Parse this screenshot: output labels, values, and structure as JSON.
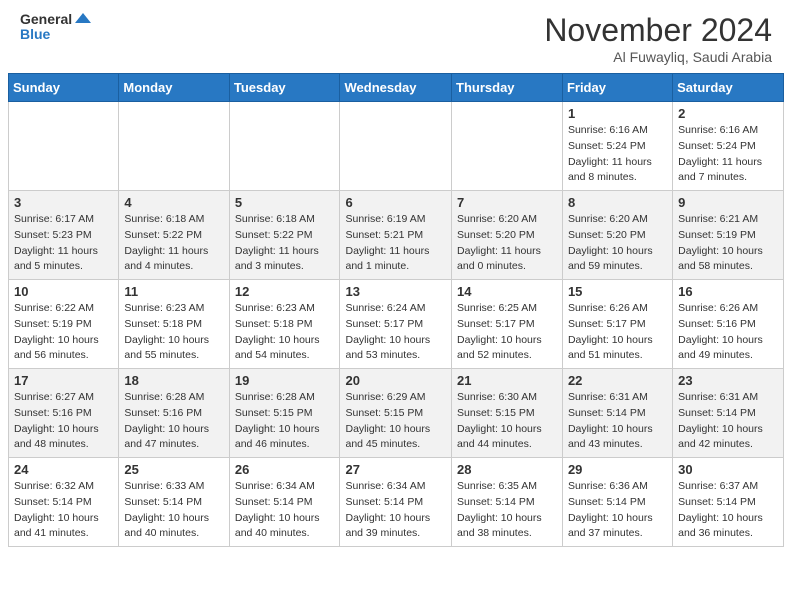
{
  "header": {
    "logo_general": "General",
    "logo_blue": "Blue",
    "month_title": "November 2024",
    "subtitle": "Al Fuwayliq, Saudi Arabia"
  },
  "calendar": {
    "days_of_week": [
      "Sunday",
      "Monday",
      "Tuesday",
      "Wednesday",
      "Thursday",
      "Friday",
      "Saturday"
    ],
    "weeks": [
      [
        {
          "day": "",
          "empty": true
        },
        {
          "day": "",
          "empty": true
        },
        {
          "day": "",
          "empty": true
        },
        {
          "day": "",
          "empty": true
        },
        {
          "day": "",
          "empty": true
        },
        {
          "day": "1",
          "sunrise": "6:16 AM",
          "sunset": "5:24 PM",
          "daylight": "11 hours and 8 minutes."
        },
        {
          "day": "2",
          "sunrise": "6:16 AM",
          "sunset": "5:24 PM",
          "daylight": "11 hours and 7 minutes."
        }
      ],
      [
        {
          "day": "3",
          "sunrise": "6:17 AM",
          "sunset": "5:23 PM",
          "daylight": "11 hours and 5 minutes."
        },
        {
          "day": "4",
          "sunrise": "6:18 AM",
          "sunset": "5:22 PM",
          "daylight": "11 hours and 4 minutes."
        },
        {
          "day": "5",
          "sunrise": "6:18 AM",
          "sunset": "5:22 PM",
          "daylight": "11 hours and 3 minutes."
        },
        {
          "day": "6",
          "sunrise": "6:19 AM",
          "sunset": "5:21 PM",
          "daylight": "11 hours and 1 minute."
        },
        {
          "day": "7",
          "sunrise": "6:20 AM",
          "sunset": "5:20 PM",
          "daylight": "11 hours and 0 minutes."
        },
        {
          "day": "8",
          "sunrise": "6:20 AM",
          "sunset": "5:20 PM",
          "daylight": "10 hours and 59 minutes."
        },
        {
          "day": "9",
          "sunrise": "6:21 AM",
          "sunset": "5:19 PM",
          "daylight": "10 hours and 58 minutes."
        }
      ],
      [
        {
          "day": "10",
          "sunrise": "6:22 AM",
          "sunset": "5:19 PM",
          "daylight": "10 hours and 56 minutes."
        },
        {
          "day": "11",
          "sunrise": "6:23 AM",
          "sunset": "5:18 PM",
          "daylight": "10 hours and 55 minutes."
        },
        {
          "day": "12",
          "sunrise": "6:23 AM",
          "sunset": "5:18 PM",
          "daylight": "10 hours and 54 minutes."
        },
        {
          "day": "13",
          "sunrise": "6:24 AM",
          "sunset": "5:17 PM",
          "daylight": "10 hours and 53 minutes."
        },
        {
          "day": "14",
          "sunrise": "6:25 AM",
          "sunset": "5:17 PM",
          "daylight": "10 hours and 52 minutes."
        },
        {
          "day": "15",
          "sunrise": "6:26 AM",
          "sunset": "5:17 PM",
          "daylight": "10 hours and 51 minutes."
        },
        {
          "day": "16",
          "sunrise": "6:26 AM",
          "sunset": "5:16 PM",
          "daylight": "10 hours and 49 minutes."
        }
      ],
      [
        {
          "day": "17",
          "sunrise": "6:27 AM",
          "sunset": "5:16 PM",
          "daylight": "10 hours and 48 minutes."
        },
        {
          "day": "18",
          "sunrise": "6:28 AM",
          "sunset": "5:16 PM",
          "daylight": "10 hours and 47 minutes."
        },
        {
          "day": "19",
          "sunrise": "6:28 AM",
          "sunset": "5:15 PM",
          "daylight": "10 hours and 46 minutes."
        },
        {
          "day": "20",
          "sunrise": "6:29 AM",
          "sunset": "5:15 PM",
          "daylight": "10 hours and 45 minutes."
        },
        {
          "day": "21",
          "sunrise": "6:30 AM",
          "sunset": "5:15 PM",
          "daylight": "10 hours and 44 minutes."
        },
        {
          "day": "22",
          "sunrise": "6:31 AM",
          "sunset": "5:14 PM",
          "daylight": "10 hours and 43 minutes."
        },
        {
          "day": "23",
          "sunrise": "6:31 AM",
          "sunset": "5:14 PM",
          "daylight": "10 hours and 42 minutes."
        }
      ],
      [
        {
          "day": "24",
          "sunrise": "6:32 AM",
          "sunset": "5:14 PM",
          "daylight": "10 hours and 41 minutes."
        },
        {
          "day": "25",
          "sunrise": "6:33 AM",
          "sunset": "5:14 PM",
          "daylight": "10 hours and 40 minutes."
        },
        {
          "day": "26",
          "sunrise": "6:34 AM",
          "sunset": "5:14 PM",
          "daylight": "10 hours and 40 minutes."
        },
        {
          "day": "27",
          "sunrise": "6:34 AM",
          "sunset": "5:14 PM",
          "daylight": "10 hours and 39 minutes."
        },
        {
          "day": "28",
          "sunrise": "6:35 AM",
          "sunset": "5:14 PM",
          "daylight": "10 hours and 38 minutes."
        },
        {
          "day": "29",
          "sunrise": "6:36 AM",
          "sunset": "5:14 PM",
          "daylight": "10 hours and 37 minutes."
        },
        {
          "day": "30",
          "sunrise": "6:37 AM",
          "sunset": "5:14 PM",
          "daylight": "10 hours and 36 minutes."
        }
      ]
    ]
  }
}
